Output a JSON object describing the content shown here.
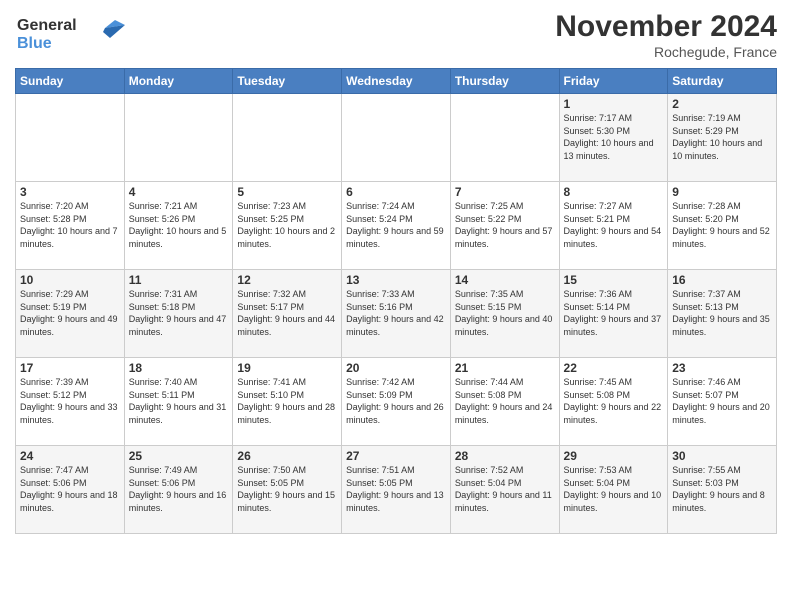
{
  "header": {
    "logo_line1": "General",
    "logo_line2": "Blue",
    "month": "November 2024",
    "location": "Rochegude, France"
  },
  "days_of_week": [
    "Sunday",
    "Monday",
    "Tuesday",
    "Wednesday",
    "Thursday",
    "Friday",
    "Saturday"
  ],
  "weeks": [
    [
      {
        "num": "",
        "info": ""
      },
      {
        "num": "",
        "info": ""
      },
      {
        "num": "",
        "info": ""
      },
      {
        "num": "",
        "info": ""
      },
      {
        "num": "",
        "info": ""
      },
      {
        "num": "1",
        "info": "Sunrise: 7:17 AM\nSunset: 5:30 PM\nDaylight: 10 hours and 13 minutes."
      },
      {
        "num": "2",
        "info": "Sunrise: 7:19 AM\nSunset: 5:29 PM\nDaylight: 10 hours and 10 minutes."
      }
    ],
    [
      {
        "num": "3",
        "info": "Sunrise: 7:20 AM\nSunset: 5:28 PM\nDaylight: 10 hours and 7 minutes."
      },
      {
        "num": "4",
        "info": "Sunrise: 7:21 AM\nSunset: 5:26 PM\nDaylight: 10 hours and 5 minutes."
      },
      {
        "num": "5",
        "info": "Sunrise: 7:23 AM\nSunset: 5:25 PM\nDaylight: 10 hours and 2 minutes."
      },
      {
        "num": "6",
        "info": "Sunrise: 7:24 AM\nSunset: 5:24 PM\nDaylight: 9 hours and 59 minutes."
      },
      {
        "num": "7",
        "info": "Sunrise: 7:25 AM\nSunset: 5:22 PM\nDaylight: 9 hours and 57 minutes."
      },
      {
        "num": "8",
        "info": "Sunrise: 7:27 AM\nSunset: 5:21 PM\nDaylight: 9 hours and 54 minutes."
      },
      {
        "num": "9",
        "info": "Sunrise: 7:28 AM\nSunset: 5:20 PM\nDaylight: 9 hours and 52 minutes."
      }
    ],
    [
      {
        "num": "10",
        "info": "Sunrise: 7:29 AM\nSunset: 5:19 PM\nDaylight: 9 hours and 49 minutes."
      },
      {
        "num": "11",
        "info": "Sunrise: 7:31 AM\nSunset: 5:18 PM\nDaylight: 9 hours and 47 minutes."
      },
      {
        "num": "12",
        "info": "Sunrise: 7:32 AM\nSunset: 5:17 PM\nDaylight: 9 hours and 44 minutes."
      },
      {
        "num": "13",
        "info": "Sunrise: 7:33 AM\nSunset: 5:16 PM\nDaylight: 9 hours and 42 minutes."
      },
      {
        "num": "14",
        "info": "Sunrise: 7:35 AM\nSunset: 5:15 PM\nDaylight: 9 hours and 40 minutes."
      },
      {
        "num": "15",
        "info": "Sunrise: 7:36 AM\nSunset: 5:14 PM\nDaylight: 9 hours and 37 minutes."
      },
      {
        "num": "16",
        "info": "Sunrise: 7:37 AM\nSunset: 5:13 PM\nDaylight: 9 hours and 35 minutes."
      }
    ],
    [
      {
        "num": "17",
        "info": "Sunrise: 7:39 AM\nSunset: 5:12 PM\nDaylight: 9 hours and 33 minutes."
      },
      {
        "num": "18",
        "info": "Sunrise: 7:40 AM\nSunset: 5:11 PM\nDaylight: 9 hours and 31 minutes."
      },
      {
        "num": "19",
        "info": "Sunrise: 7:41 AM\nSunset: 5:10 PM\nDaylight: 9 hours and 28 minutes."
      },
      {
        "num": "20",
        "info": "Sunrise: 7:42 AM\nSunset: 5:09 PM\nDaylight: 9 hours and 26 minutes."
      },
      {
        "num": "21",
        "info": "Sunrise: 7:44 AM\nSunset: 5:08 PM\nDaylight: 9 hours and 24 minutes."
      },
      {
        "num": "22",
        "info": "Sunrise: 7:45 AM\nSunset: 5:08 PM\nDaylight: 9 hours and 22 minutes."
      },
      {
        "num": "23",
        "info": "Sunrise: 7:46 AM\nSunset: 5:07 PM\nDaylight: 9 hours and 20 minutes."
      }
    ],
    [
      {
        "num": "24",
        "info": "Sunrise: 7:47 AM\nSunset: 5:06 PM\nDaylight: 9 hours and 18 minutes."
      },
      {
        "num": "25",
        "info": "Sunrise: 7:49 AM\nSunset: 5:06 PM\nDaylight: 9 hours and 16 minutes."
      },
      {
        "num": "26",
        "info": "Sunrise: 7:50 AM\nSunset: 5:05 PM\nDaylight: 9 hours and 15 minutes."
      },
      {
        "num": "27",
        "info": "Sunrise: 7:51 AM\nSunset: 5:05 PM\nDaylight: 9 hours and 13 minutes."
      },
      {
        "num": "28",
        "info": "Sunrise: 7:52 AM\nSunset: 5:04 PM\nDaylight: 9 hours and 11 minutes."
      },
      {
        "num": "29",
        "info": "Sunrise: 7:53 AM\nSunset: 5:04 PM\nDaylight: 9 hours and 10 minutes."
      },
      {
        "num": "30",
        "info": "Sunrise: 7:55 AM\nSunset: 5:03 PM\nDaylight: 9 hours and 8 minutes."
      }
    ]
  ]
}
